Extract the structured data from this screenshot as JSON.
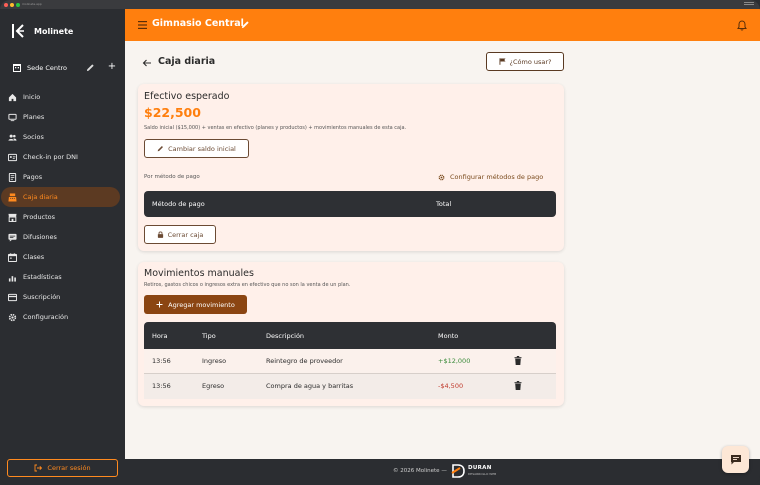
{
  "browser": {
    "url": "molinete.app"
  },
  "colors": {
    "accent": "#ff7f0e",
    "sidebar": "#2b2d31",
    "card": "#fff0ea",
    "positive": "#3a8b3a",
    "negative": "#c0392b"
  },
  "sidebar": {
    "brand": "Molinete",
    "sede": "Sede Centro",
    "items": [
      {
        "label": "Inicio",
        "icon": "home-icon"
      },
      {
        "label": "Planes",
        "icon": "plans-icon"
      },
      {
        "label": "Socios",
        "icon": "users-icon"
      },
      {
        "label": "Check-in por DNI",
        "icon": "id-card-icon"
      },
      {
        "label": "Pagos",
        "icon": "payments-icon"
      },
      {
        "label": "Caja diaria",
        "icon": "cash-register-icon",
        "active": true
      },
      {
        "label": "Productos",
        "icon": "store-icon"
      },
      {
        "label": "Difusiones",
        "icon": "broadcast-icon"
      },
      {
        "label": "Clases",
        "icon": "calendar-icon"
      },
      {
        "label": "Estadísticas",
        "icon": "chart-icon"
      },
      {
        "label": "Suscripción",
        "icon": "credit-card-icon"
      },
      {
        "label": "Configuración",
        "icon": "gear-icon"
      }
    ],
    "logout": "Cerrar sesión"
  },
  "topbar": {
    "title": "Gimnasio Central"
  },
  "page": {
    "title": "Caja diaria",
    "help": "¿Cómo usar?"
  },
  "expected": {
    "title": "Efectivo esperado",
    "amount": "$22,500",
    "description": "Saldo inicial ($15,000) + ventas en efectivo (planes y productos) + movimientos manuales de esta caja.",
    "change_button": "Cambiar saldo inicial",
    "by_method": "Por método de pago",
    "config_link": "Configurar métodos de pago",
    "table_headers": [
      "Método de pago",
      "Total"
    ],
    "close_button": "Cerrar caja"
  },
  "manual": {
    "title": "Movimientos manuales",
    "description": "Retiros, gastos chicos o ingresos extra en efectivo que no son la venta de un plan.",
    "add_button": "Agregar movimiento",
    "headers": [
      "Hora",
      "Tipo",
      "Descripción",
      "Monto"
    ],
    "rows": [
      {
        "hora": "13:56",
        "tipo": "Ingreso",
        "descripcion": "Reintegro de proveedor",
        "monto": "+$12,000",
        "sign": "pos"
      },
      {
        "hora": "13:56",
        "tipo": "Egreso",
        "descripcion": "Compra de agua y barritas",
        "monto": "-$4,500",
        "sign": "neg"
      }
    ]
  },
  "footer": {
    "text": "© 2026 Molinete —",
    "brand": "DURAN",
    "tagline": "DESARROLLO WEB"
  }
}
